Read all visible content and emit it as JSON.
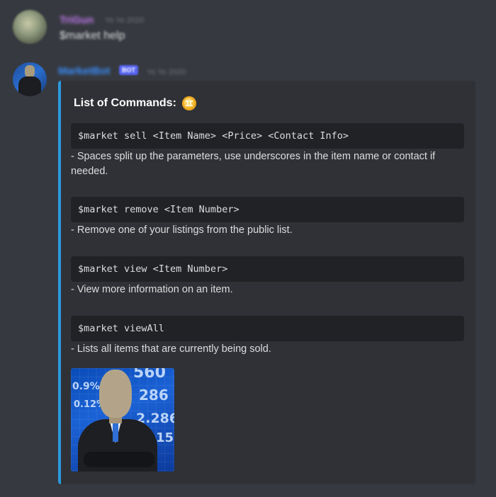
{
  "messages": [
    {
      "author": "TriGun",
      "timestamp": "Yo Yo 2020",
      "content": "$market help"
    },
    {
      "author": "MarketBot",
      "badge": "BOT",
      "timestamp": "Yo Yo 2020"
    }
  ],
  "embed": {
    "title": "List of Commands:",
    "title_icon": "bank-coin-icon",
    "accent_color": "#2c99de",
    "commands": [
      {
        "code": "$market sell <Item Name> <Price> <Contact Info>",
        "description": "- Spaces split up the parameters, use underscores in the item name or contact if needed."
      },
      {
        "code": "$market remove <Item Number>",
        "description": "- Remove one of your listings from the public list."
      },
      {
        "code": "$market view <Item Number>",
        "description": "- View more information on an item."
      },
      {
        "code": "$market viewAll",
        "description": "- Lists all items that are currently being sold."
      }
    ],
    "image": {
      "alt": "stonks-meme-image",
      "ticker_texts": [
        "560",
        "0.9%",
        "286",
        "0.12%",
        "2.286",
        "15"
      ]
    }
  }
}
